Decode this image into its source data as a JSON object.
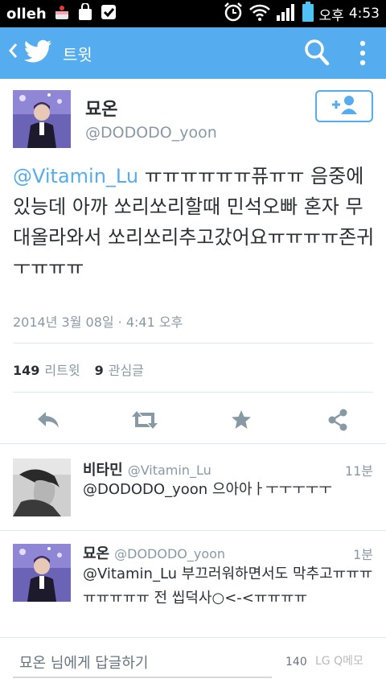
{
  "status_bar": {
    "carrier": "olleh",
    "ampm": "오후",
    "time": "4:53"
  },
  "action_bar": {
    "title": "트윗",
    "icons": [
      "back-arrow-icon",
      "twitter-bird-icon",
      "search-icon",
      "overflow-menu-icon"
    ]
  },
  "tweet": {
    "name": "묘온",
    "handle": "@DODODO_yoon",
    "mention": "@Vitamin_Lu",
    "text": " ㅠㅠㅠㅠㅠㅠ퓨ㅠㅠ 음중에 있능데 아까 쏘리쏘리할때 민석오빠 혼자 무대올라와서 쏘리쏘리추고갔어요ㅠㅠㅠㅠ존귀ㅜㅠㅠㅠ",
    "timestamp": "2014년 3월 08일 · 4:41 오후",
    "retweets_count": "149",
    "retweets_label": "리트윗",
    "favorites_count": "9",
    "favorites_label": "관심글"
  },
  "replies": [
    {
      "name": "비타민",
      "handle": "@Vitamin_Lu",
      "time": "11분",
      "text": "@DODODO_yoon 으아아ㅏㅜㅜㅜㅜㅜ"
    },
    {
      "name": "묘온",
      "handle": "@DODODO_yoon",
      "time": "1분",
      "text": "@Vitamin_Lu 부끄러워하면서도 막추고ㅠㅠㅠㅠㅠㅠㅠㅠ 전 씹덕사○<-<ㅠㅠㅠㅠ"
    }
  ],
  "compose": {
    "placeholder": "묘온 님에게 답글하기",
    "char_count": "140"
  },
  "colors": {
    "twitter_blue": "#55acee",
    "text_dark": "#292f33",
    "text_gray": "#8899a6"
  }
}
